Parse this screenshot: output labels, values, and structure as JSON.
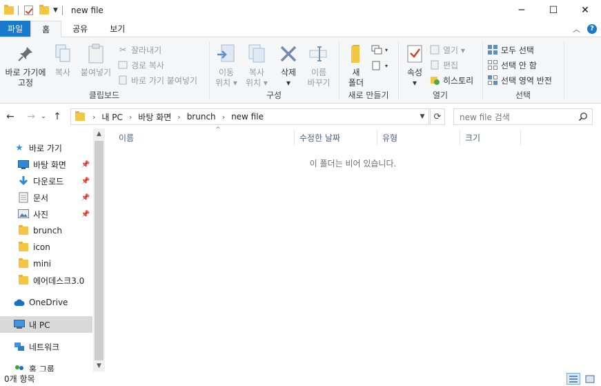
{
  "window": {
    "title": "new file",
    "controls": {
      "minimize": "─",
      "maximize": "☐",
      "close": "✕"
    }
  },
  "ribbon_tabs": [
    {
      "label": "파일",
      "kind": "file"
    },
    {
      "label": "홈",
      "kind": "active"
    },
    {
      "label": "공유",
      "kind": "normal"
    },
    {
      "label": "보기",
      "kind": "normal"
    }
  ],
  "ribbon": {
    "clipboard": {
      "label": "클립보드",
      "pin_quick": "바로 가기에\n고정",
      "copy": "복사",
      "paste": "붙여넣기",
      "cut": "잘라내기",
      "copy_path": "경로 복사",
      "paste_shortcut": "바로 가기 붙여넣기"
    },
    "organize": {
      "label": "구성",
      "move_to": "이동\n위치 ▾",
      "copy_to": "복사\n위치 ▾",
      "delete": "삭제\n▾",
      "rename": "이름\n바꾸기"
    },
    "new": {
      "label": "새로 만들기",
      "new_folder": "새\n폴더"
    },
    "open": {
      "label": "열기",
      "properties": "속성\n▾",
      "open": "열기 ▾",
      "edit": "편집",
      "history": "히스토리"
    },
    "select": {
      "label": "선택",
      "select_all": "모두 선택",
      "select_none": "선택 안 함",
      "invert": "선택 영역 반전"
    }
  },
  "address": {
    "crumbs": [
      "내 PC",
      "바탕 화면",
      "brunch",
      "new file"
    ],
    "search_placeholder": "new file 검색"
  },
  "nav": {
    "items": [
      {
        "label": "바로 가기",
        "icon": "star-icon",
        "pinned": false
      },
      {
        "label": "바탕 화면",
        "icon": "desktop-icon",
        "pinned": true
      },
      {
        "label": "다운로드",
        "icon": "download-icon",
        "pinned": true
      },
      {
        "label": "문서",
        "icon": "document-icon",
        "pinned": true
      },
      {
        "label": "사진",
        "icon": "pictures-icon",
        "pinned": true
      },
      {
        "label": "brunch",
        "icon": "folder-icon",
        "pinned": false
      },
      {
        "label": "icon",
        "icon": "folder-icon",
        "pinned": false
      },
      {
        "label": "mini",
        "icon": "folder-icon",
        "pinned": false
      },
      {
        "label": "에어데스크3.0",
        "icon": "folder-icon",
        "pinned": false
      },
      {
        "label": "OneDrive",
        "icon": "cloud-icon",
        "pinned": false
      },
      {
        "label": "내 PC",
        "icon": "computer-icon",
        "pinned": false
      },
      {
        "label": "네트워크",
        "icon": "network-icon",
        "pinned": false
      },
      {
        "label": "홈 그룹",
        "icon": "homegroup-icon",
        "pinned": false
      }
    ]
  },
  "columns": [
    "이름",
    "수정한 날짜",
    "유형",
    "크기"
  ],
  "empty_message": "이 폴더는 비어 있습니다.",
  "status": {
    "item_count": "0개 항목"
  },
  "colors": {
    "accent": "#1979ca",
    "selected_nav": "#d9d9d9"
  }
}
